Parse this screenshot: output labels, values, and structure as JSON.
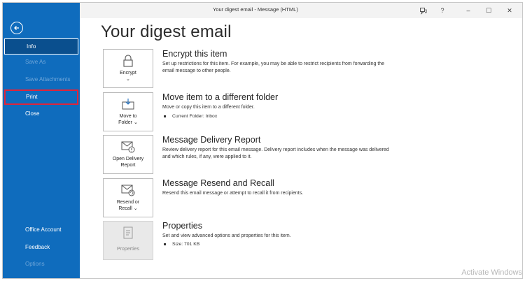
{
  "window": {
    "title": "Your digest email  -  Message (HTML)",
    "controls": {
      "minimize": "–",
      "restore": "☐",
      "close": "✕",
      "help": "?"
    }
  },
  "sidebar": {
    "items": [
      {
        "label": "Info",
        "state": "selected"
      },
      {
        "label": "Save As",
        "state": "disabled"
      },
      {
        "label": "Save Attachments",
        "state": "disabled"
      },
      {
        "label": "Print",
        "state": "highlighted"
      },
      {
        "label": "Close",
        "state": "normal"
      },
      {
        "label": "Office Account",
        "state": "normal"
      },
      {
        "label": "Feedback",
        "state": "normal"
      },
      {
        "label": "Options",
        "state": "disabled"
      }
    ]
  },
  "main": {
    "title": "Your digest email",
    "sections": [
      {
        "tile_label": "Encrypt\n⌄",
        "heading": "Encrypt this item",
        "description": "Set up restrictions for this item. For example, you may be able to restrict recipients from forwarding the email message to other people."
      },
      {
        "tile_label": "Move to\nFolder ⌄",
        "heading": "Move item to a different folder",
        "description": "Move or copy this item to a different folder.",
        "bullet": "Current Folder:   Inbox"
      },
      {
        "tile_label": "Open Delivery\nReport",
        "heading": "Message Delivery Report",
        "description": "Review delivery report for this email message. Delivery report includes when the message was delivered and which rules, if any, were applied to it."
      },
      {
        "tile_label": "Resend or\nRecall ⌄",
        "heading": "Message Resend and Recall",
        "description": "Resend this email message or attempt to recall it from recipients."
      },
      {
        "tile_label": "Properties",
        "heading": "Properties",
        "description": "Set and view advanced options and properties for this item.",
        "bullet": "Size:   701 KB"
      }
    ]
  },
  "watermark": "Activate Windows",
  "colors": {
    "sidebar": "#0f6cbd",
    "selected": "#0a4f8e",
    "print_highlight": "#e0243a"
  }
}
